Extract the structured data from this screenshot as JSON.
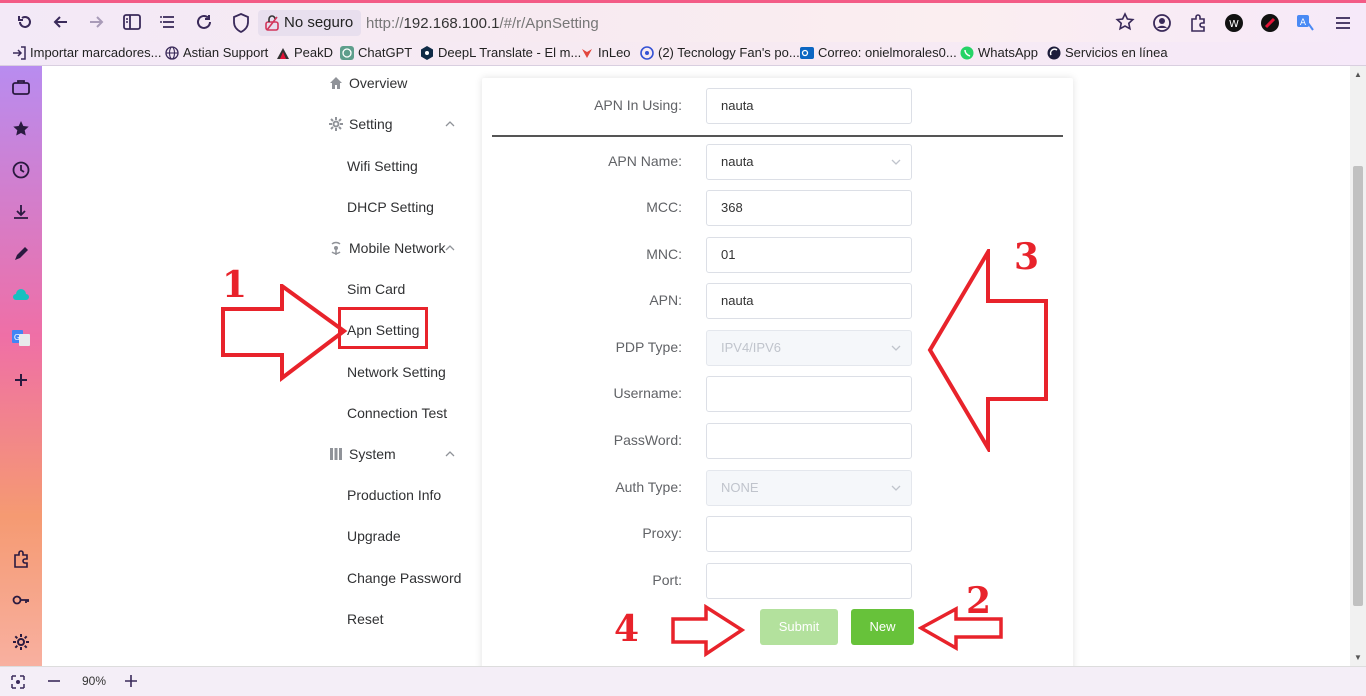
{
  "browser": {
    "security_label": "No seguro",
    "url_prefix": "http://",
    "url_host": "192.168.100.1",
    "url_path": "/#/r/ApnSetting",
    "zoom_level": "90%"
  },
  "bookmarks": [
    {
      "label": "Importar marcadores..."
    },
    {
      "label": "Astian Support"
    },
    {
      "label": "PeakD"
    },
    {
      "label": "ChatGPT"
    },
    {
      "label": "DeepL Translate - El m..."
    },
    {
      "label": "InLeo"
    },
    {
      "label": "(2) Tecnology Fan's po..."
    },
    {
      "label": "Correo: onielmorales0..."
    },
    {
      "label": "WhatsApp"
    },
    {
      "label": "Servicios en línea"
    }
  ],
  "menu": {
    "overview": "Overview",
    "setting": "Setting",
    "wifi_setting": "Wifi Setting",
    "dhcp_setting": "DHCP Setting",
    "mobile_network": "Mobile Network",
    "sim_card": "Sim Card",
    "apn_setting": "Apn Setting",
    "network_setting": "Network Setting",
    "connection_test": "Connection Test",
    "system": "System",
    "production_info": "Production Info",
    "upgrade": "Upgrade",
    "change_password": "Change Password",
    "reset": "Reset"
  },
  "form": {
    "apn_in_using_label": "APN In Using:",
    "apn_in_using_value": "nauta",
    "apn_name_label": "APN Name:",
    "apn_name_value": "nauta",
    "mcc_label": "MCC:",
    "mcc_value": "368",
    "mnc_label": "MNC:",
    "mnc_value": "01",
    "apn_label": "APN:",
    "apn_value": "nauta",
    "pdp_type_label": "PDP Type:",
    "pdp_type_value": "IPV4/IPV6",
    "username_label": "Username:",
    "username_value": "",
    "password_label": "PassWord:",
    "password_value": "",
    "auth_type_label": "Auth Type:",
    "auth_type_value": "NONE",
    "proxy_label": "Proxy:",
    "proxy_value": "",
    "port_label": "Port:",
    "port_value": "",
    "submit_label": "Submit",
    "new_label": "New"
  },
  "annotations": {
    "n1": "1",
    "n2": "2",
    "n3": "3",
    "n4": "4",
    "color": "#e8232b"
  },
  "colors": {
    "primary_green": "#67c23a",
    "disabled_green": "#b3e19d",
    "tab_accent": "#f35b86"
  }
}
